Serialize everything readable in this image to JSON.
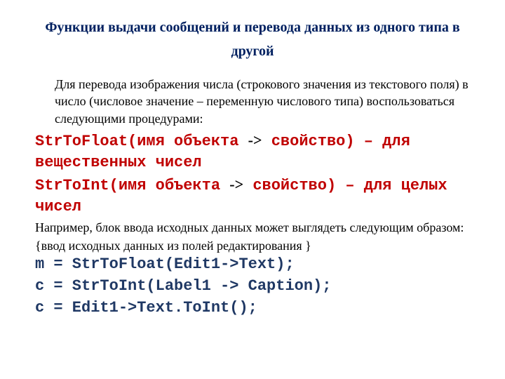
{
  "title": "Функции выдачи сообщений и перевода данных из одного типа в другой",
  "intro": "Для перевода изображения числа (строкового значения из текстового поля) в число (числовое значение – переменную числового типа) воспользоваться следующими процедурами:",
  "func1_a": "StrToFloat(имя объекта",
  "arrow": "->",
  "func1_b": "свойство) – для вещественных чисел",
  "func2_a": "StrToInt(имя объекта",
  "func2_b": "свойство) – для целых чисел",
  "example_lead": " Например, блок ввода исходных данных может выглядеть следующим образом:",
  "comment": "{ввод исходных данных из полей редактирования }",
  "code1": "m = StrToFloat(Edit1->Text);",
  "code2": "c = StrToInt(Label1 -> Caption);",
  "code3": "c = Edit1->Text.ToInt();"
}
